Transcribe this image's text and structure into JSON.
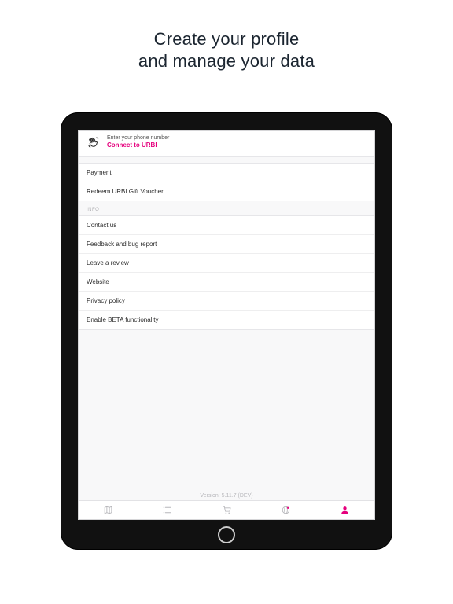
{
  "headline": {
    "line1": "Create your profile",
    "line2": "and manage your data"
  },
  "connect": {
    "sub": "Enter your phone number",
    "main": "Connect to URBI"
  },
  "group1": {
    "items": [
      "Payment",
      "Redeem URBI Gift Voucher"
    ]
  },
  "section_info": "INFO",
  "group2": {
    "items": [
      "Contact us",
      "Feedback and bug report",
      "Leave a review",
      "Website",
      "Privacy policy",
      "Enable BETA functionality"
    ]
  },
  "version": "Version: 5.11.7 (DEV)",
  "tabs": {
    "map": "map-icon",
    "list": "list-icon",
    "cart": "cart-icon",
    "globe": "globe-icon",
    "profile": "profile-icon"
  }
}
